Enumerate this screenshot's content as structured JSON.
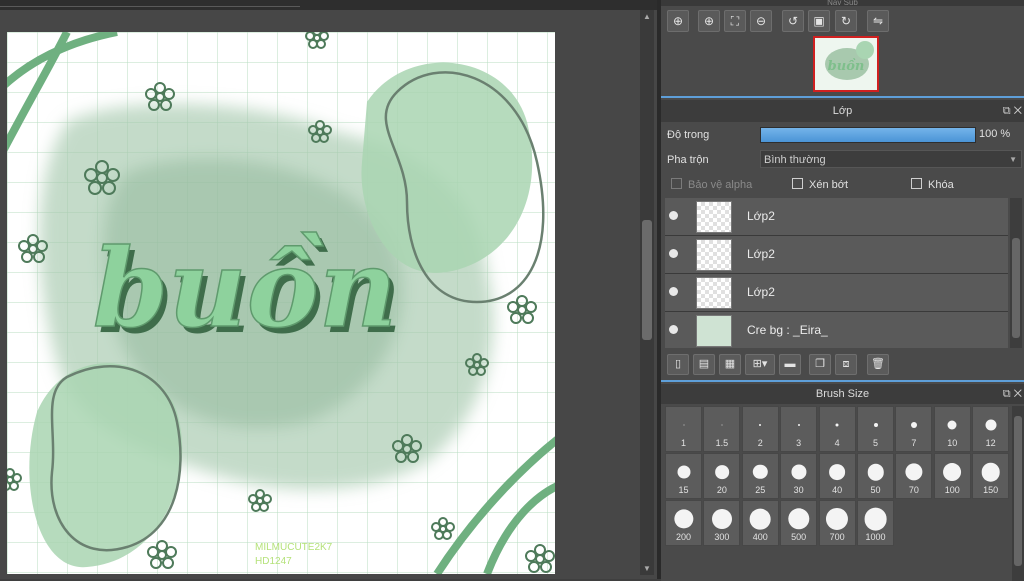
{
  "colors": {
    "accent": "#5e9fd9",
    "artwork_green": "#7fbf8c",
    "art_text": "#8ed29d",
    "watermark": "#b5e27a",
    "highlight_red": "#d02020"
  },
  "artwork": {
    "title_text": "buồn",
    "watermark_line1": "MILMUCUTE2K7",
    "watermark_line2": "HD1247"
  },
  "navigator": {
    "title": "Nav Sub",
    "tools": [
      "zoom-in-icon",
      "zoom-plus-icon",
      "fit-icon",
      "zoom-minus-icon",
      "rotate-left-icon",
      "fullscreen-icon",
      "rotate-right-icon",
      "flip-icon"
    ]
  },
  "layer_panel": {
    "title": "Lớp",
    "opacity_label": "Độ trong",
    "opacity_value": "100 %",
    "opacity_fraction": 1.0,
    "blend_label": "Pha trộn",
    "blend_value": "Bình thường",
    "protect_alpha": "Bảo vệ alpha",
    "clipping": "Xén bớt",
    "lock": "Khóa",
    "layers": [
      {
        "name": "Lớp2"
      },
      {
        "name": "Lớp2"
      },
      {
        "name": "Lớp2"
      },
      {
        "name": "Cre bg : _Eira_"
      }
    ]
  },
  "brush_panel": {
    "title": "Brush Size",
    "sizes": [
      "1",
      "1.5",
      "2",
      "3",
      "4",
      "5",
      "7",
      "10",
      "12",
      "15",
      "20",
      "25",
      "30",
      "40",
      "50",
      "70",
      "100",
      "150",
      "200",
      "300",
      "400",
      "500",
      "700",
      "1000"
    ]
  }
}
